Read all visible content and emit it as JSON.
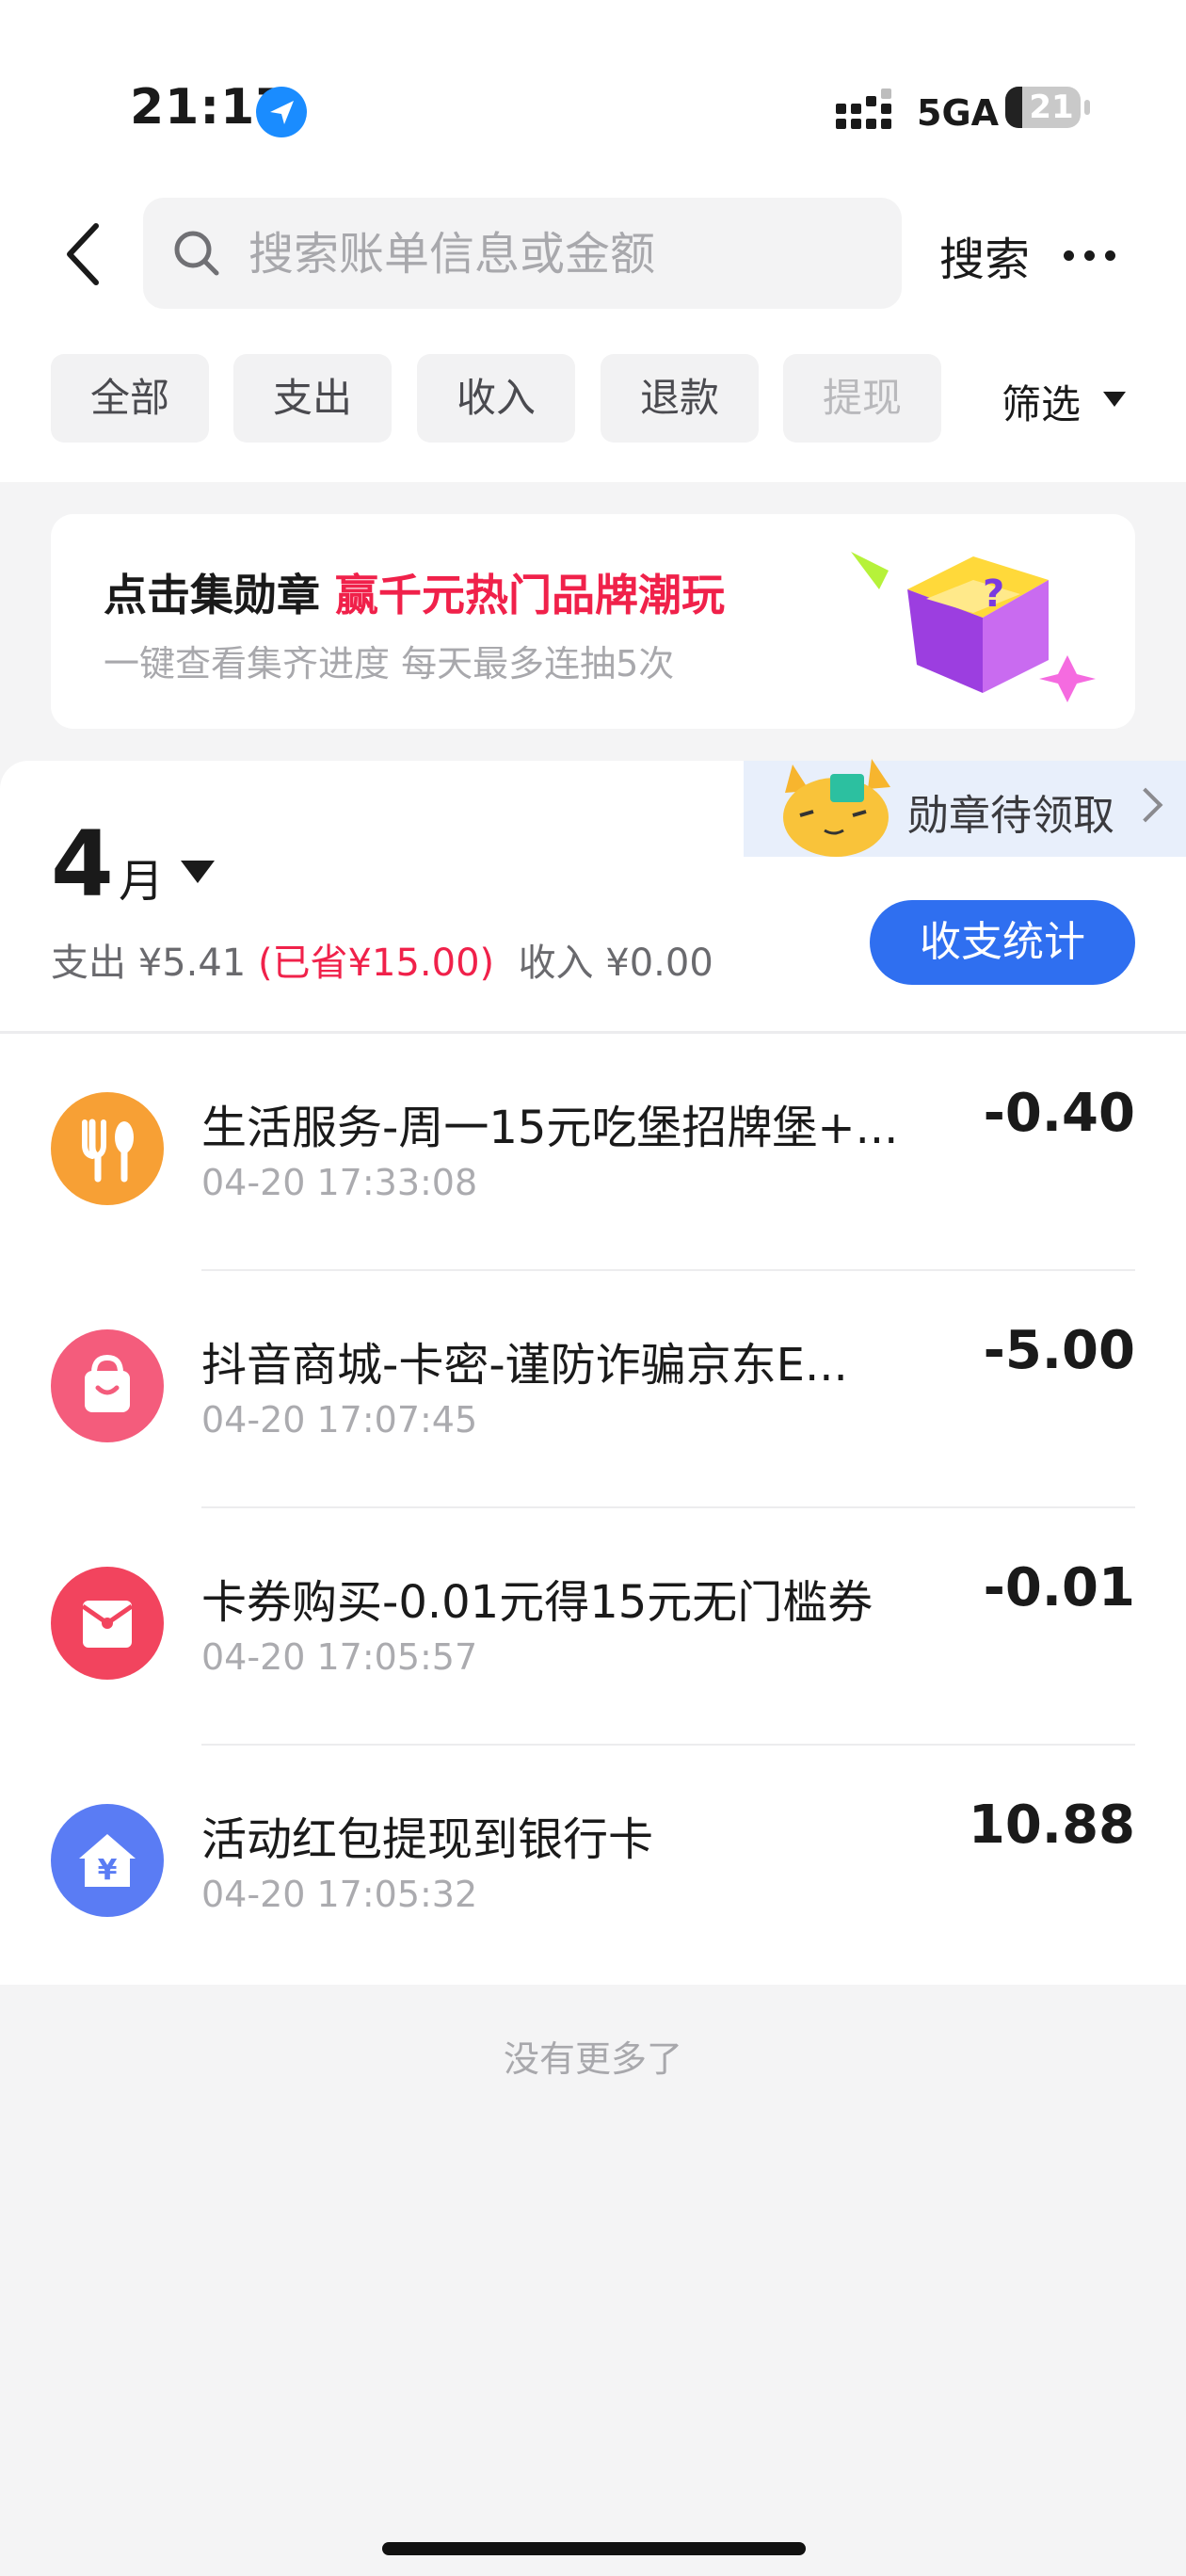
{
  "status_bar": {
    "time": "21:17",
    "network": "5GA",
    "battery": "21"
  },
  "search": {
    "placeholder": "搜索账单信息或金额",
    "button_label": "搜索"
  },
  "tabs": [
    "全部",
    "支出",
    "收入",
    "退款",
    "提现"
  ],
  "filter_label": "筛选",
  "banner": {
    "title_prefix": "点击集勋章",
    "title_highlight": "赢千元热门品牌潮玩",
    "subtitle": "一键查看集齐进度 每天最多连抽5次"
  },
  "medal_tag": "勋章待领取",
  "month": {
    "number": "4",
    "unit": "月",
    "expense_label": "支出 ¥5.41",
    "saved_label": "(已省¥15.00)",
    "income_label": "收入 ¥0.00",
    "stats_button": "收支统计"
  },
  "transactions": [
    {
      "icon": "fork-spoon-icon",
      "color": "#f7a035",
      "title": "生活服务-周一15元吃堡招牌堡+...",
      "time": "04-20 17:33:08",
      "amount": "-0.40"
    },
    {
      "icon": "shopping-bag-icon",
      "color": "#f45c7c",
      "title": "抖音商城-卡密-谨防诈骗京东E...",
      "time": "04-20 17:07:45",
      "amount": "-5.00"
    },
    {
      "icon": "coupon-envelope-icon",
      "color": "#f2445e",
      "title": "卡券购买-0.01元得15元无门槛券",
      "time": "04-20 17:05:57",
      "amount": "-0.01"
    },
    {
      "icon": "yuan-house-icon",
      "color": "#5a7cf4",
      "title": "活动红包提现到银行卡",
      "time": "04-20 17:05:32",
      "amount": "10.88"
    }
  ],
  "footer": {
    "no_more": "没有更多了"
  }
}
